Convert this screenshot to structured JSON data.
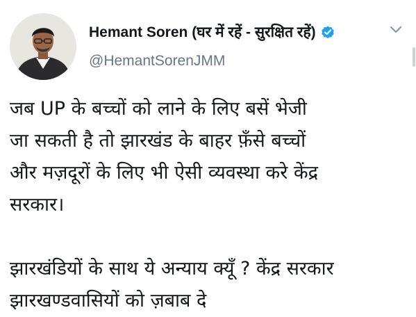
{
  "author": {
    "name": "Hemant Soren (घर में रहें - सुरक्षित रहें)",
    "handle": "@HemantSorenJMM",
    "verified": true,
    "verified_color": "#1da1f2"
  },
  "menu": {
    "icon": "chevron-down-icon"
  },
  "tweet": {
    "paragraph1": [
      "जब UP के बच्चों को लाने के लिए बसें भेजी",
      "जा सकती है तो झारखंड के बाहर फ़ँसे बच्चों",
      "और मज़दूरों के लिए भी ऐसी व्यवस्था करे केंद्र",
      "सरकार।"
    ],
    "paragraph2": [
      "झारखंडियों के साथ ये अन्याय क्यूँ ? केंद्र सरकार",
      "झारखण्डवासियों को ज़बाब दे"
    ]
  }
}
